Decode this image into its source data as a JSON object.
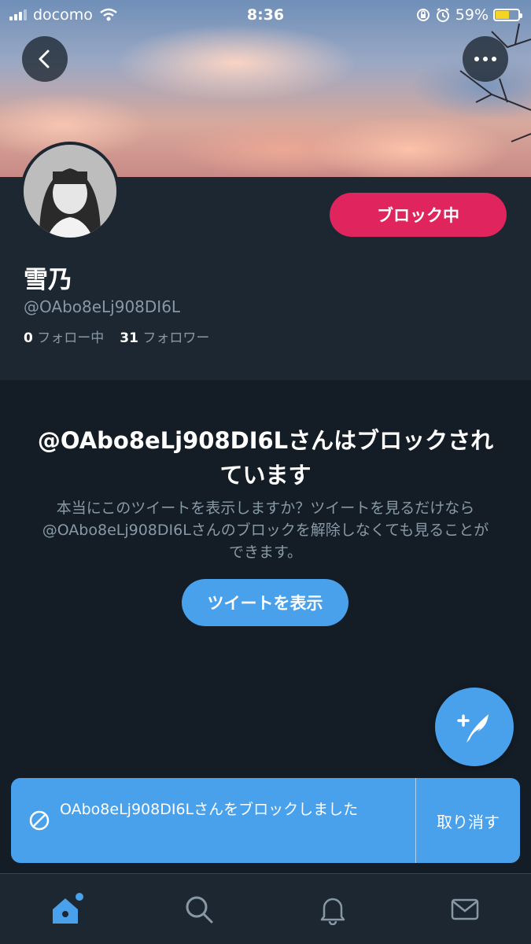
{
  "status_bar": {
    "carrier": "docomo",
    "time": "8:36",
    "battery": "59%"
  },
  "profile": {
    "name": "雪乃",
    "handle": "@OAbo8eLj908DI6L",
    "following_count": "0",
    "following_label": "フォロー中",
    "followers_count": "31",
    "followers_label": "フォロワー",
    "block_button_label": "ブロック中"
  },
  "notice": {
    "title": "@OAbo8eLj908DI6Lさんはブロックされています",
    "body": "本当にこのツイートを表示しますか？ツイートを見るだけなら@OAbo8eLj908DI6Lさんのブロックを解除しなくても見ることができます。",
    "show_button_label": "ツイートを表示"
  },
  "toast": {
    "message": "OAbo8eLj908DI6Lさんをブロックしました",
    "undo_label": "取り消す"
  },
  "colors": {
    "block_red": "#e0245e",
    "accent_blue": "#4aa1eb",
    "background": "#141d26",
    "panel": "#1c2732",
    "secondary_text": "#8899a6"
  },
  "icons": [
    "back-arrow-icon",
    "more-options-icon",
    "compose-tweet-icon",
    "blocked-icon",
    "home-icon",
    "search-icon",
    "notifications-icon",
    "messages-icon"
  ]
}
